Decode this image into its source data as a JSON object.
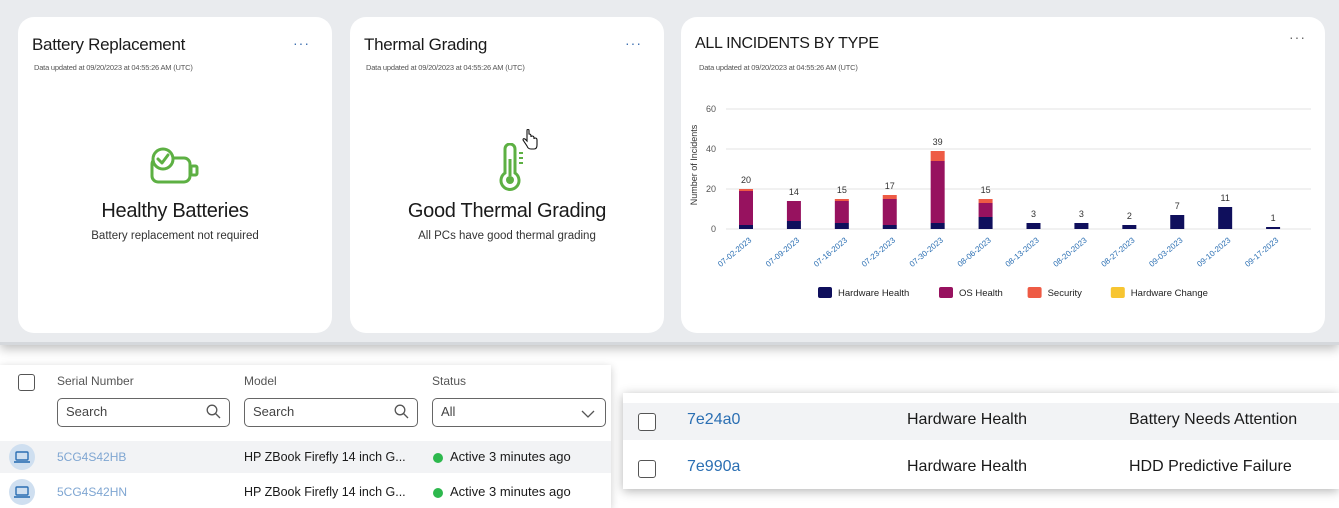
{
  "cards": {
    "battery": {
      "title": "Battery Replacement",
      "updated": "Data updated at 09/20/2023 at 04:55:26 AM (UTC)",
      "menu": "···",
      "icon": "battery-check-icon",
      "headline": "Healthy Batteries",
      "detail": "Battery replacement not required"
    },
    "thermal": {
      "title": "Thermal Grading",
      "updated": "Data updated at 09/20/2023 at 04:55:26 AM (UTC)",
      "menu": "···",
      "icon": "thermometer-icon",
      "headline": "Good Thermal Grading",
      "detail": "All PCs have good thermal grading"
    },
    "incidents": {
      "title": "ALL INCIDENTS BY TYPE",
      "updated": "Data updated at 09/20/2023 at 04:55:26 AM (UTC)",
      "menu": "···"
    }
  },
  "colors": {
    "hardware_health": "#0f0f5c",
    "os_health": "#97125f",
    "security": "#ee5b45",
    "hardware_change": "#f7c531",
    "accent_green": "#5db043",
    "link_blue": "#2b6fb3"
  },
  "chart_data": {
    "type": "bar",
    "stacked": true,
    "title": "ALL INCIDENTS BY TYPE",
    "xlabel": "",
    "ylabel": "Number of Incidents",
    "ylim": [
      0,
      60
    ],
    "yticks": [
      0,
      20,
      40,
      60
    ],
    "grid": true,
    "legend_position": "bottom",
    "categories": [
      "07-02-2023",
      "07-09-2023",
      "07-16-2023",
      "07-23-2023",
      "07-30-2023",
      "08-06-2023",
      "08-13-2023",
      "08-20-2023",
      "08-27-2023",
      "09-03-2023",
      "09-10-2023",
      "09-17-2023"
    ],
    "totals": [
      20,
      14,
      15,
      17,
      39,
      15,
      3,
      3,
      2,
      7,
      11,
      1
    ],
    "series": [
      {
        "name": "Hardware Health",
        "color": "#0f0f5c",
        "values": [
          2,
          4,
          3,
          2,
          3,
          6,
          3,
          3,
          2,
          7,
          11,
          1
        ]
      },
      {
        "name": "OS Health",
        "color": "#97125f",
        "values": [
          17,
          10,
          11,
          13,
          31,
          7,
          0,
          0,
          0,
          0,
          0,
          0
        ]
      },
      {
        "name": "Security",
        "color": "#ee5b45",
        "values": [
          1,
          0,
          1,
          2,
          5,
          2,
          0,
          0,
          0,
          0,
          0,
          0
        ]
      },
      {
        "name": "Hardware Change",
        "color": "#f7c531",
        "values": [
          0,
          0,
          0,
          0,
          0,
          0,
          0,
          0,
          0,
          0,
          0,
          0
        ]
      }
    ]
  },
  "device_table": {
    "columns": {
      "serial": "Serial Number",
      "model": "Model",
      "status": "Status"
    },
    "filters": {
      "serial_placeholder": "Search",
      "model_placeholder": "Search",
      "status_value": "All"
    },
    "rows": [
      {
        "serial": "5CG4S42HB",
        "model": "HP ZBook Firefly 14 inch G...",
        "status": "Active 3 minutes ago"
      },
      {
        "serial": "5CG4S42HN",
        "model": "HP ZBook Firefly 14 inch G...",
        "status": "Active 3 minutes ago"
      }
    ]
  },
  "incident_list": {
    "rows": [
      {
        "id": "7e24a0",
        "type": "Hardware Health",
        "description": "Battery Needs Attention"
      },
      {
        "id": "7e990a",
        "type": "Hardware Health",
        "description": "HDD Predictive Failure"
      }
    ]
  }
}
